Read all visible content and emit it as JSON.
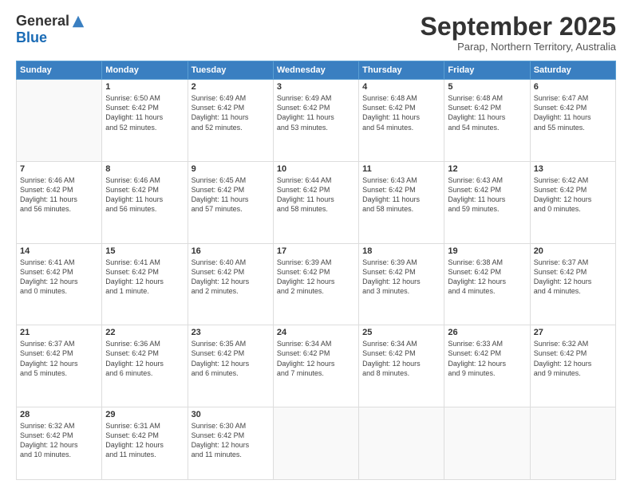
{
  "logo": {
    "general": "General",
    "blue": "Blue"
  },
  "title": "September 2025",
  "subtitle": "Parap, Northern Territory, Australia",
  "weekdays": [
    "Sunday",
    "Monday",
    "Tuesday",
    "Wednesday",
    "Thursday",
    "Friday",
    "Saturday"
  ],
  "weeks": [
    [
      {
        "day": null,
        "info": null
      },
      {
        "day": "1",
        "info": "Sunrise: 6:50 AM\nSunset: 6:42 PM\nDaylight: 11 hours\nand 52 minutes."
      },
      {
        "day": "2",
        "info": "Sunrise: 6:49 AM\nSunset: 6:42 PM\nDaylight: 11 hours\nand 52 minutes."
      },
      {
        "day": "3",
        "info": "Sunrise: 6:49 AM\nSunset: 6:42 PM\nDaylight: 11 hours\nand 53 minutes."
      },
      {
        "day": "4",
        "info": "Sunrise: 6:48 AM\nSunset: 6:42 PM\nDaylight: 11 hours\nand 54 minutes."
      },
      {
        "day": "5",
        "info": "Sunrise: 6:48 AM\nSunset: 6:42 PM\nDaylight: 11 hours\nand 54 minutes."
      },
      {
        "day": "6",
        "info": "Sunrise: 6:47 AM\nSunset: 6:42 PM\nDaylight: 11 hours\nand 55 minutes."
      }
    ],
    [
      {
        "day": "7",
        "info": "Sunrise: 6:46 AM\nSunset: 6:42 PM\nDaylight: 11 hours\nand 56 minutes."
      },
      {
        "day": "8",
        "info": "Sunrise: 6:46 AM\nSunset: 6:42 PM\nDaylight: 11 hours\nand 56 minutes."
      },
      {
        "day": "9",
        "info": "Sunrise: 6:45 AM\nSunset: 6:42 PM\nDaylight: 11 hours\nand 57 minutes."
      },
      {
        "day": "10",
        "info": "Sunrise: 6:44 AM\nSunset: 6:42 PM\nDaylight: 11 hours\nand 58 minutes."
      },
      {
        "day": "11",
        "info": "Sunrise: 6:43 AM\nSunset: 6:42 PM\nDaylight: 11 hours\nand 58 minutes."
      },
      {
        "day": "12",
        "info": "Sunrise: 6:43 AM\nSunset: 6:42 PM\nDaylight: 11 hours\nand 59 minutes."
      },
      {
        "day": "13",
        "info": "Sunrise: 6:42 AM\nSunset: 6:42 PM\nDaylight: 12 hours\nand 0 minutes."
      }
    ],
    [
      {
        "day": "14",
        "info": "Sunrise: 6:41 AM\nSunset: 6:42 PM\nDaylight: 12 hours\nand 0 minutes."
      },
      {
        "day": "15",
        "info": "Sunrise: 6:41 AM\nSunset: 6:42 PM\nDaylight: 12 hours\nand 1 minute."
      },
      {
        "day": "16",
        "info": "Sunrise: 6:40 AM\nSunset: 6:42 PM\nDaylight: 12 hours\nand 2 minutes."
      },
      {
        "day": "17",
        "info": "Sunrise: 6:39 AM\nSunset: 6:42 PM\nDaylight: 12 hours\nand 2 minutes."
      },
      {
        "day": "18",
        "info": "Sunrise: 6:39 AM\nSunset: 6:42 PM\nDaylight: 12 hours\nand 3 minutes."
      },
      {
        "day": "19",
        "info": "Sunrise: 6:38 AM\nSunset: 6:42 PM\nDaylight: 12 hours\nand 4 minutes."
      },
      {
        "day": "20",
        "info": "Sunrise: 6:37 AM\nSunset: 6:42 PM\nDaylight: 12 hours\nand 4 minutes."
      }
    ],
    [
      {
        "day": "21",
        "info": "Sunrise: 6:37 AM\nSunset: 6:42 PM\nDaylight: 12 hours\nand 5 minutes."
      },
      {
        "day": "22",
        "info": "Sunrise: 6:36 AM\nSunset: 6:42 PM\nDaylight: 12 hours\nand 6 minutes."
      },
      {
        "day": "23",
        "info": "Sunrise: 6:35 AM\nSunset: 6:42 PM\nDaylight: 12 hours\nand 6 minutes."
      },
      {
        "day": "24",
        "info": "Sunrise: 6:34 AM\nSunset: 6:42 PM\nDaylight: 12 hours\nand 7 minutes."
      },
      {
        "day": "25",
        "info": "Sunrise: 6:34 AM\nSunset: 6:42 PM\nDaylight: 12 hours\nand 8 minutes."
      },
      {
        "day": "26",
        "info": "Sunrise: 6:33 AM\nSunset: 6:42 PM\nDaylight: 12 hours\nand 9 minutes."
      },
      {
        "day": "27",
        "info": "Sunrise: 6:32 AM\nSunset: 6:42 PM\nDaylight: 12 hours\nand 9 minutes."
      }
    ],
    [
      {
        "day": "28",
        "info": "Sunrise: 6:32 AM\nSunset: 6:42 PM\nDaylight: 12 hours\nand 10 minutes."
      },
      {
        "day": "29",
        "info": "Sunrise: 6:31 AM\nSunset: 6:42 PM\nDaylight: 12 hours\nand 11 minutes."
      },
      {
        "day": "30",
        "info": "Sunrise: 6:30 AM\nSunset: 6:42 PM\nDaylight: 12 hours\nand 11 minutes."
      },
      {
        "day": null,
        "info": null
      },
      {
        "day": null,
        "info": null
      },
      {
        "day": null,
        "info": null
      },
      {
        "day": null,
        "info": null
      }
    ]
  ]
}
